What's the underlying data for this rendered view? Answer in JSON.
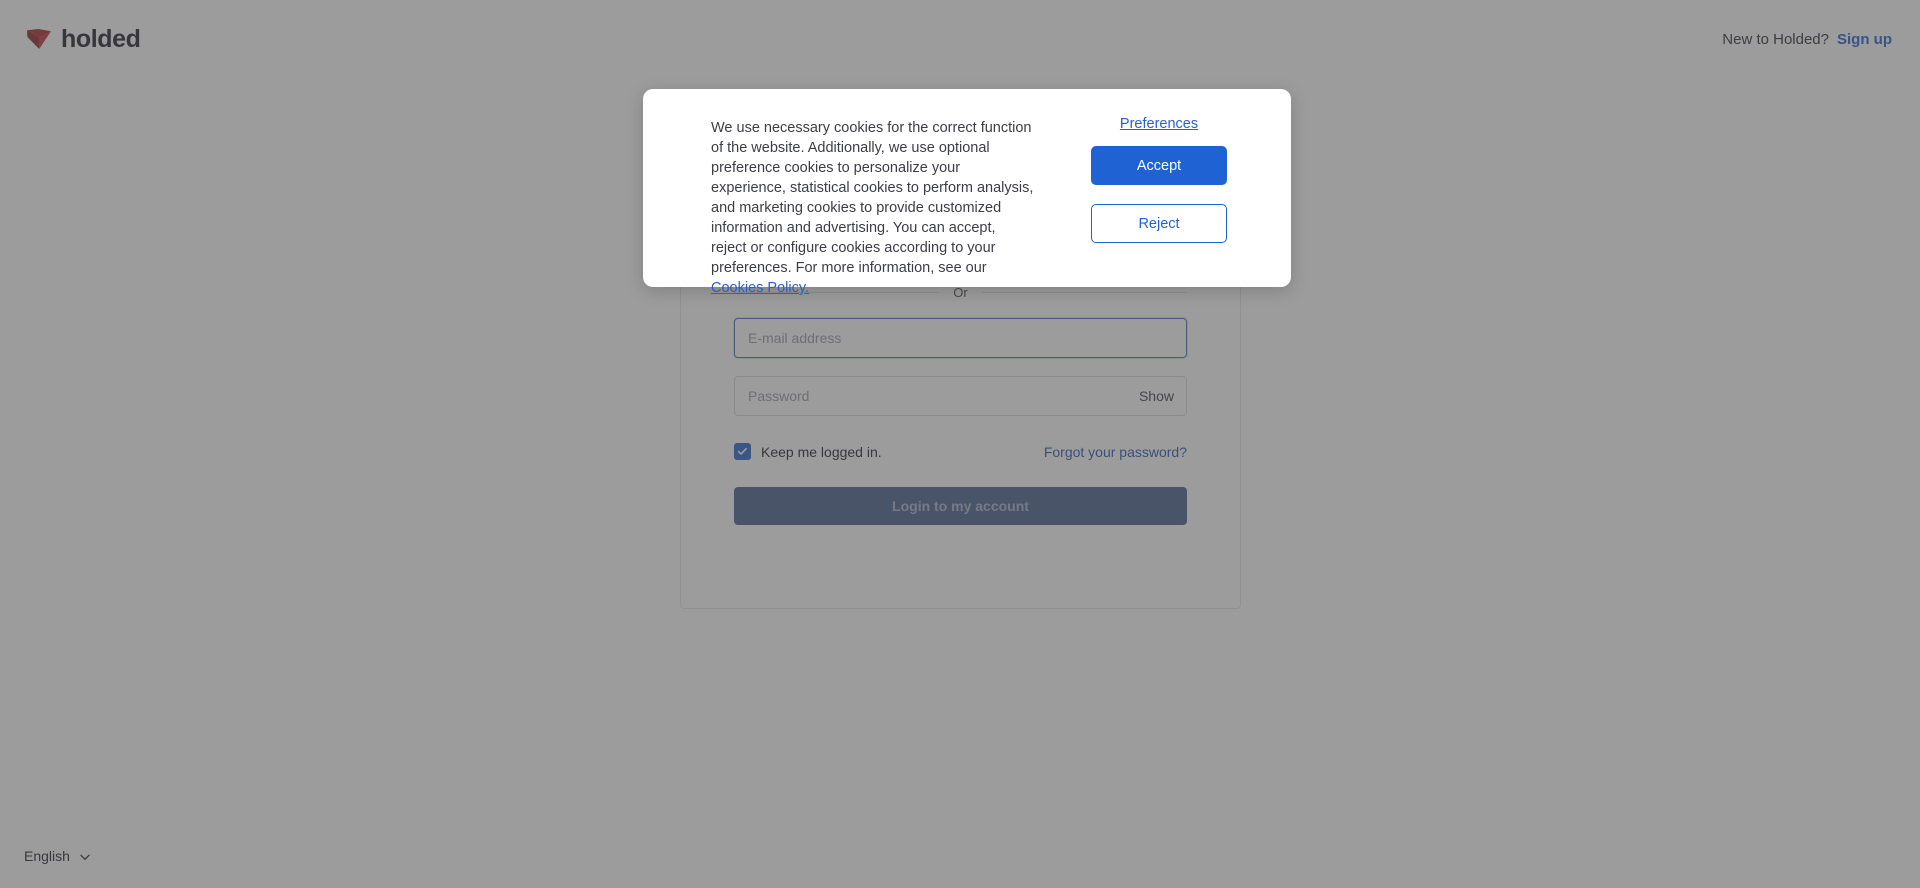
{
  "brand": {
    "name": "holded",
    "logo_color": "#b02a2a"
  },
  "topbar": {
    "prompt": "New to Holded?",
    "signup_label": "Sign up"
  },
  "login": {
    "divider_label": "Or",
    "email": {
      "placeholder": "E-mail address",
      "value": ""
    },
    "password": {
      "placeholder": "Password",
      "value": "",
      "show_label": "Show"
    },
    "keep_logged_in": {
      "label": "Keep me logged in.",
      "checked": true
    },
    "forgot_label": "Forgot your password?",
    "submit_label": "Login to my account"
  },
  "language": {
    "selected": "English"
  },
  "cookie_dialog": {
    "body_text": "We use necessary cookies for the correct function of the website. Additionally, we use optional preference cookies to personalize your experience, statistical cookies to perform analysis, and marketing cookies to provide customized information and advertising. You can accept, reject or configure cookies according to your preferences. For more information, see our ",
    "policy_link_label": "Cookies Policy.",
    "preferences_label": "Preferences",
    "accept_label": "Accept",
    "reject_label": "Reject",
    "accent_color": "#1f62d4"
  }
}
